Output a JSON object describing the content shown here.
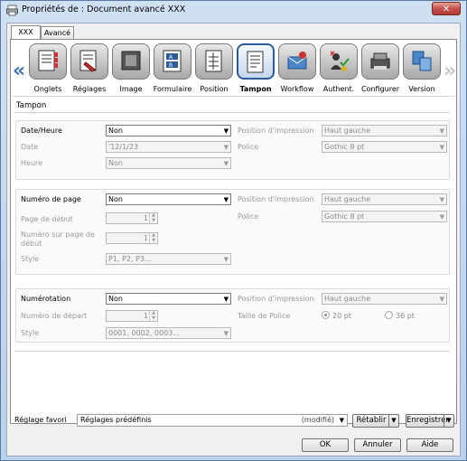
{
  "window": {
    "title": "Propriétés de : Document avancé XXX",
    "close_label": "✕"
  },
  "tabs": [
    {
      "label": "XXX"
    },
    {
      "label": "Avancé"
    }
  ],
  "iconbar": {
    "left_arrow": "«",
    "right_arrow": "»",
    "items": [
      {
        "label": "Onglets"
      },
      {
        "label": "Réglages"
      },
      {
        "label": "Image"
      },
      {
        "label": "Formulaire"
      },
      {
        "label": "Position"
      },
      {
        "label": "Tampon"
      },
      {
        "label": "Workflow"
      },
      {
        "label": "Authent."
      },
      {
        "label": "Configurer"
      },
      {
        "label": "Version"
      }
    ]
  },
  "section_title": "Tampon",
  "date_group": {
    "label": "Date/Heure",
    "value": "Non",
    "date_label": "Date",
    "date_value": "'12/1/23",
    "heure_label": "Heure",
    "heure_value": "Non",
    "pos_label": "Position d'impression",
    "pos_value": "Haut gauche",
    "police_label": "Police",
    "police_value": "Gothic 8 pt"
  },
  "page_group": {
    "label": "Numéro de page",
    "value": "Non",
    "start_label": "Page de début",
    "start_value": "1",
    "num_label": "Numéro sur page de début",
    "num_value": "1",
    "style_label": "Style",
    "style_value": "P1, P2, P3...",
    "pos_label": "Position d'impression",
    "pos_value": "Haut gauche",
    "police_label": "Police",
    "police_value": "Gothic 8 pt"
  },
  "num_group": {
    "label": "Numérotation",
    "value": "Non",
    "start_label": "Numéro de départ",
    "start_value": "1",
    "style_label": "Style",
    "style_value": "0001, 0002, 0003...",
    "pos_label": "Position d'impression",
    "pos_value": "Haut gauche",
    "size_label": "Taille de Police",
    "size_opt1": "20 pt",
    "size_opt2": "36 pt",
    "size_selected": "20 pt"
  },
  "favorites": {
    "label": "Réglage favori",
    "value": "Réglages prédéfinis",
    "modified": "(modifié)",
    "restore": "Rétablir",
    "save": "Enregistrer"
  },
  "buttons": {
    "ok": "OK",
    "cancel": "Annuler",
    "help": "Aide"
  }
}
